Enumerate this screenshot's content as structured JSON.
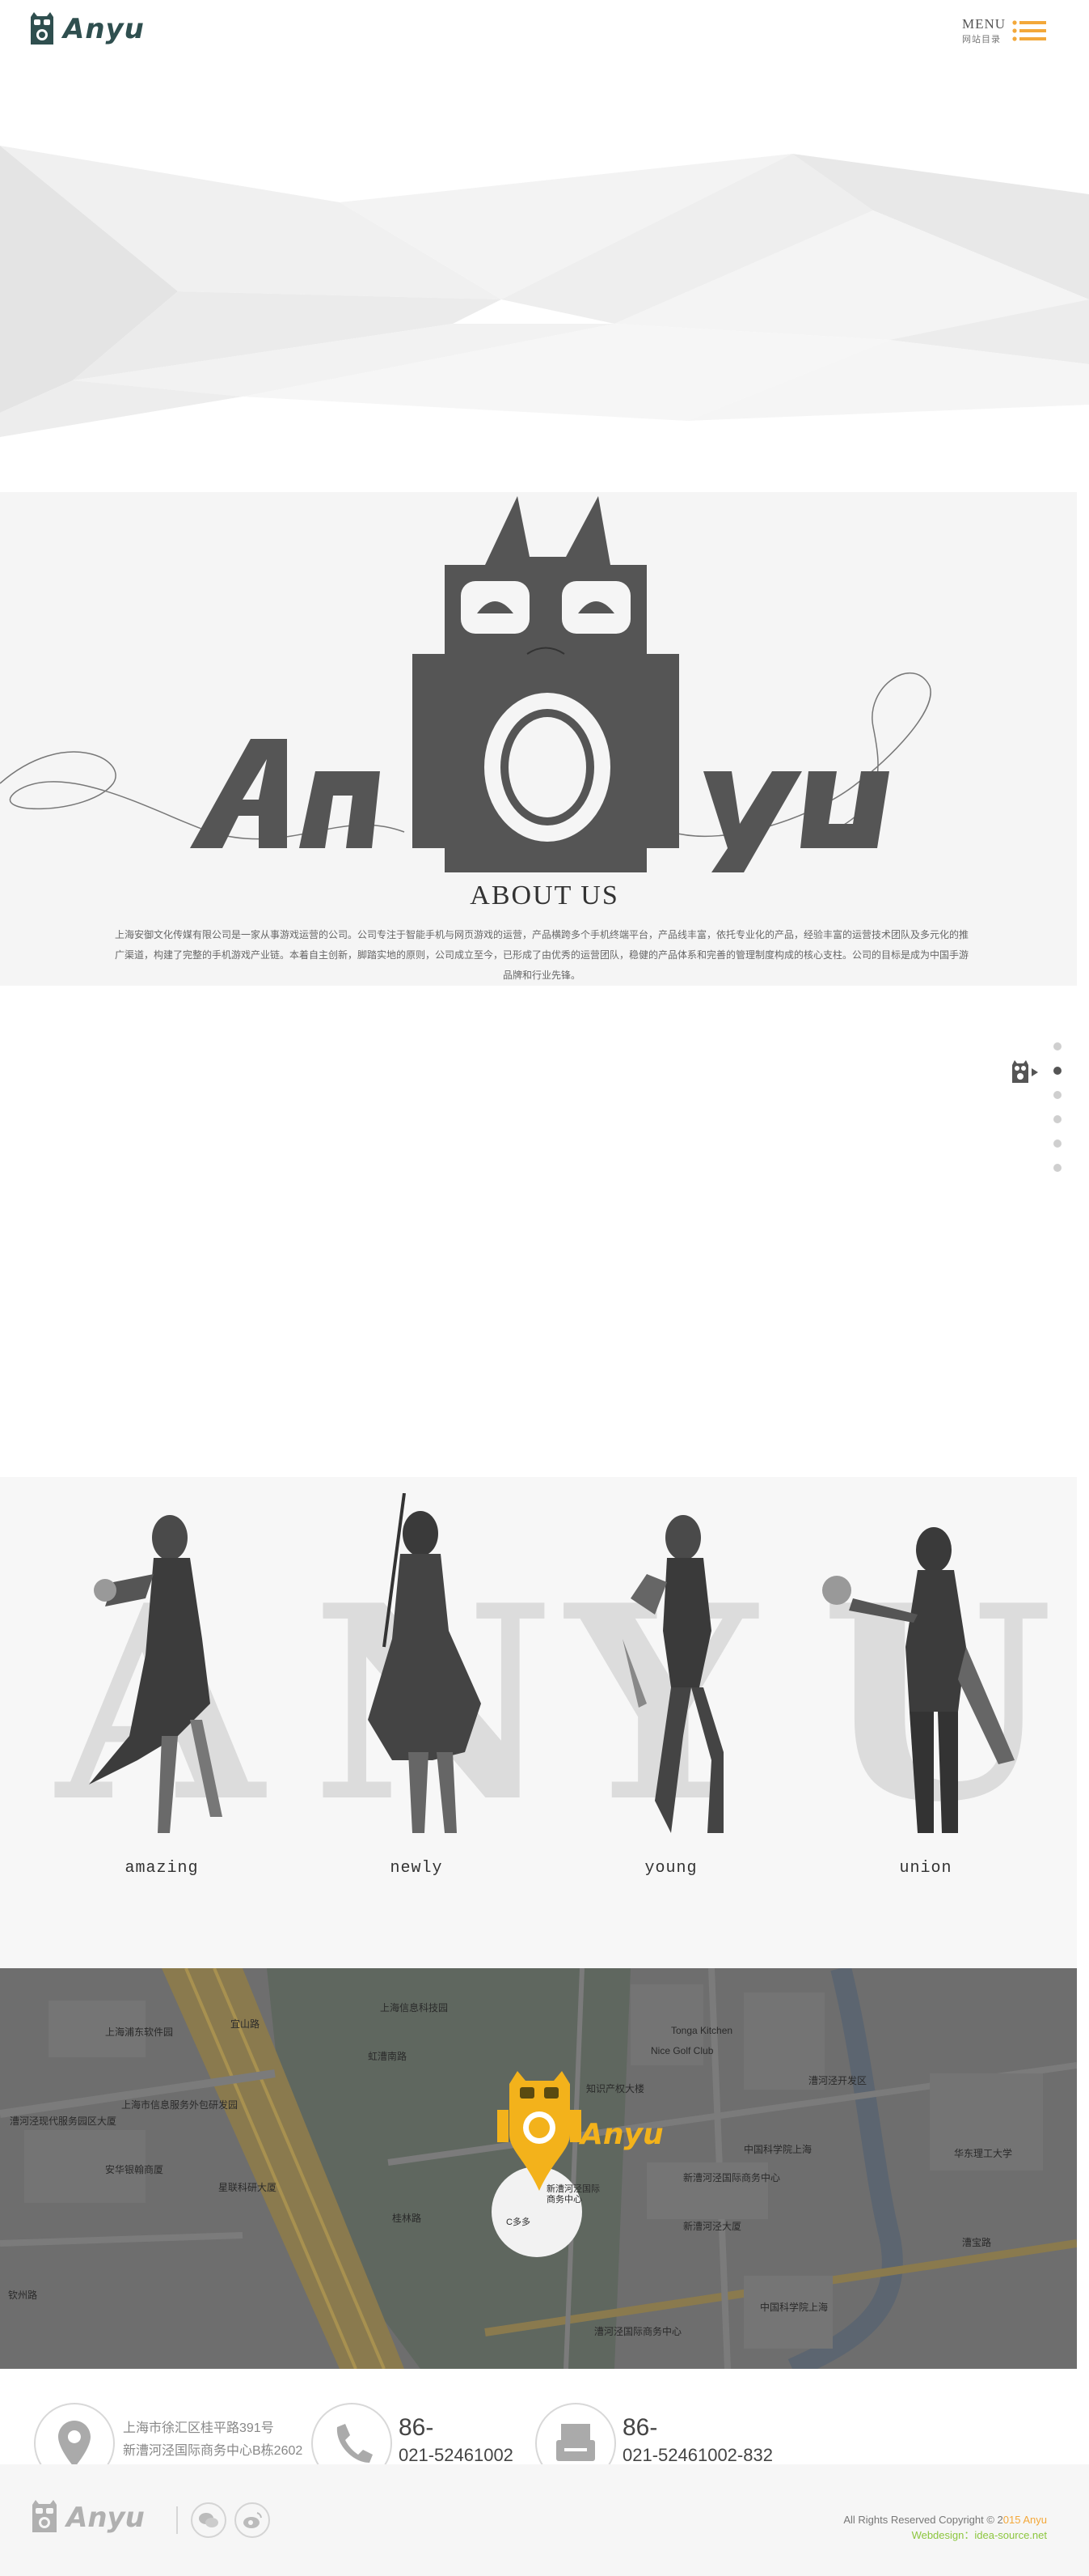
{
  "header": {
    "logo_text": "Anyu",
    "menu_label": "MENU",
    "menu_sublabel": "网站目录"
  },
  "about": {
    "title": "ABOUT US",
    "logo_text": "Anyu",
    "body": "上海安御文化传媒有限公司是一家从事游戏运营的公司。公司专注于智能手机与网页游戏的运营，产品横跨多个手机终端平台，产品线丰富，依托专业化的产品，经验丰富的运营技术团队及多元化的推广渠道，构建了完整的手机游戏产业链。本着自主创新，脚踏实地的原则，公司成立至今，已形成了由优秀的运营团队，稳健的产品体系和完善的管理制度构成的核心支柱。公司的目标是成为中国手游品牌和行业先锋。"
  },
  "scroll_nav": {
    "count": 6,
    "active_index": 1
  },
  "characters": {
    "watermark": "ANYU",
    "items": [
      {
        "label": "amazing",
        "letter": "A"
      },
      {
        "label": "newly",
        "letter": "N"
      },
      {
        "label": "young",
        "letter": "Y"
      },
      {
        "label": "union",
        "letter": "U"
      }
    ]
  },
  "map": {
    "marker_brand": "Anyu",
    "labels": [
      "上海浦东软件园",
      "漕河泾现代服务园区大厦",
      "上海市信息服务外包研发园",
      "安华银翰商厦",
      "星联科研大厦",
      "知识产权大楼",
      "Tonga Kitchen",
      "Nice Golf Club",
      "中国科学院上海",
      "新漕河泾国际商务中心",
      "新漕河泾国际商务中心",
      "中国科学院上海",
      "华东理工大学",
      "漕河泾开发区",
      "漕宝路",
      "桂林路",
      "虹漕南路",
      "新漕河泾大厦",
      "钦州路",
      "宜山路",
      "C多多",
      "上海信息科技园",
      "漕河泾国际商务中心",
      "漕河泾开发区"
    ]
  },
  "contact": {
    "address_line1": "上海市徐汇区桂平路391号",
    "address_line2": "新漕河泾国际商务中心B栋2602",
    "phone_prefix": "86-",
    "phone_number": "021-52461002",
    "fax_prefix": "86-",
    "fax_number": "021-52461002-832"
  },
  "footer": {
    "logo_text": "Anyu",
    "copyright_prefix": "All Rights Reserved  Copyright © 2",
    "copyright_year_tail": "015 Anyu",
    "webdesign_label": "Webdesign：",
    "webdesign_value": "idea-source.net"
  },
  "colors": {
    "accent": "#f3a83a",
    "dark_gray": "#555555",
    "light_bg": "#f5f5f5",
    "map_dim": "#6c6c6c"
  }
}
